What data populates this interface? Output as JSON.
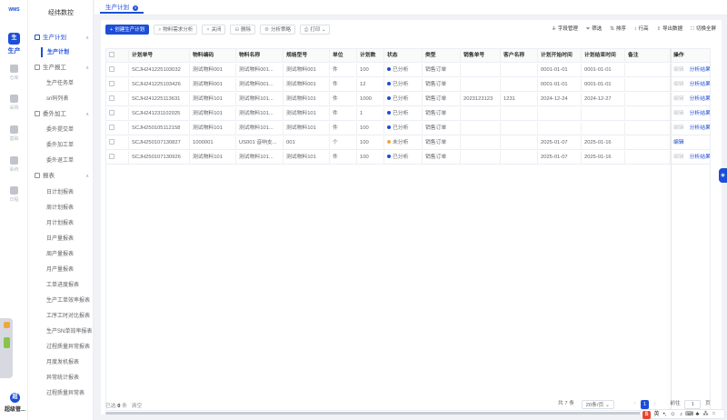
{
  "rail": {
    "logo": "WMS",
    "items": [
      {
        "label": "生产",
        "active": true
      },
      {
        "label": "仓库"
      },
      {
        "label": "采购"
      },
      {
        "label": "基础"
      },
      {
        "label": "系统"
      },
      {
        "label": "日程"
      }
    ],
    "user_label": "超级管..."
  },
  "sidebar": {
    "title": "经纬数控",
    "groups": [
      {
        "label": "生产计划",
        "active": true,
        "items": [
          {
            "label": "生产计划",
            "active": true
          }
        ]
      },
      {
        "label": "生产报工",
        "items": [
          {
            "label": "生产任务单"
          },
          {
            "label": "sn码列表"
          }
        ]
      },
      {
        "label": "委外加工",
        "items": [
          {
            "label": "委外提交单"
          },
          {
            "label": "委外加工单"
          },
          {
            "label": "委外退工单"
          }
        ]
      },
      {
        "label": "报表",
        "items": [
          {
            "label": "日计划报表"
          },
          {
            "label": "周计划报表"
          },
          {
            "label": "月计划报表"
          },
          {
            "label": "日产量报表"
          },
          {
            "label": "周产量报表"
          },
          {
            "label": "月产量报表"
          },
          {
            "label": "工单进度报表"
          },
          {
            "label": "生产工单效率报表"
          },
          {
            "label": "工序工时对比报表"
          },
          {
            "label": "生产SN单效率报表"
          },
          {
            "label": "过程质量异常报表"
          },
          {
            "label": "月度发机报表"
          },
          {
            "label": "异常统计报表"
          },
          {
            "label": "过程质量异常表"
          }
        ]
      }
    ]
  },
  "tab": {
    "label": "生产计划"
  },
  "toolbar": {
    "create": "创建生产计划",
    "analyze": "物料需求分析",
    "close": "关闭",
    "delete": "删除",
    "strategy": "分析策略",
    "print": "打印",
    "fields": "字段管理",
    "filter": "筛选",
    "sort": "排序",
    "row_height": "行高",
    "export": "导出数据",
    "fullscreen": "切换全屏"
  },
  "table": {
    "columns": [
      "计划单号",
      "物料编码",
      "物料名称",
      "规格型号",
      "单位",
      "计划数",
      "状态",
      "类型",
      "销售单号",
      "客户名称",
      "计划开始时间",
      "计划结束时间",
      "备注",
      "操作"
    ],
    "rows": [
      {
        "plan_no": "SCJH241225103032",
        "code": "测试物料001",
        "name": "测试物料001...",
        "spec": "测试物料001",
        "unit": "件",
        "qty": "100",
        "status": "已分析",
        "status_color": "#1d4ed8",
        "type": "销售订单",
        "sales_no": "",
        "customer": "",
        "start": "0001-01-01",
        "end": "0001-01-01",
        "remark": "",
        "actions": [
          "编辑",
          "分析结果"
        ],
        "edit_disabled": true
      },
      {
        "plan_no": "SCJH241225103426",
        "code": "测试物料001",
        "name": "测试物料001...",
        "spec": "测试物料001",
        "unit": "件",
        "qty": "12",
        "status": "已分析",
        "status_color": "#1d4ed8",
        "type": "销售订单",
        "sales_no": "",
        "customer": "",
        "start": "0001-01-01",
        "end": "0001-01-01",
        "remark": "",
        "actions": [
          "编辑",
          "分析结果"
        ],
        "edit_disabled": true
      },
      {
        "plan_no": "SCJH241225113631",
        "code": "测试物料101",
        "name": "测试物料101...",
        "spec": "测试物料101",
        "unit": "件",
        "qty": "1000",
        "status": "已分析",
        "status_color": "#1d4ed8",
        "type": "销售订单",
        "sales_no": "2023123123",
        "customer": "1231",
        "start": "2024-12-24",
        "end": "2024-12-27",
        "remark": "",
        "actions": [
          "编辑",
          "分析结果"
        ],
        "edit_disabled": true
      },
      {
        "plan_no": "SCJH241231102025",
        "code": "测试物料101",
        "name": "测试物料101...",
        "spec": "测试物料101",
        "unit": "件",
        "qty": "1",
        "status": "已分析",
        "status_color": "#1d4ed8",
        "type": "销售订单",
        "sales_no": "",
        "customer": "",
        "start": "",
        "end": "",
        "remark": "",
        "actions": [
          "编辑",
          "分析结果"
        ],
        "edit_disabled": true
      },
      {
        "plan_no": "SCJH250105112158",
        "code": "测试物料101",
        "name": "测试物料101...",
        "spec": "测试物料101",
        "unit": "件",
        "qty": "100",
        "status": "已分析",
        "status_color": "#1d4ed8",
        "type": "销售订单",
        "sales_no": "",
        "customer": "",
        "start": "",
        "end": "",
        "remark": "",
        "actions": [
          "编辑",
          "分析结果"
        ],
        "edit_disabled": true
      },
      {
        "plan_no": "SCJH250107130827",
        "code": "1000001",
        "name": "US001 音响支...",
        "spec": "001",
        "unit": "个",
        "qty": "100",
        "status": "未分析",
        "status_color": "#f0a640",
        "type": "销售订单",
        "sales_no": "",
        "customer": "",
        "start": "2025-01-07",
        "end": "2025-01-16",
        "remark": "",
        "actions": [
          "编辑"
        ],
        "edit_disabled": false
      },
      {
        "plan_no": "SCJH250107130926",
        "code": "测试物料101",
        "name": "测试物料101...",
        "spec": "测试物料101",
        "unit": "件",
        "qty": "100",
        "status": "已分析",
        "status_color": "#1d4ed8",
        "type": "销售订单",
        "sales_no": "",
        "customer": "",
        "start": "2025-01-07",
        "end": "2025-01-16",
        "remark": "",
        "actions": [
          "编辑",
          "分析结果"
        ],
        "edit_disabled": true
      }
    ]
  },
  "footer": {
    "selected_prefix": "已选",
    "selected_count": "0",
    "selected_suffix": "条",
    "clear": "清空"
  },
  "pager": {
    "total": "共 7 条",
    "page_size": "20条/页",
    "prev": "‹",
    "page": "1",
    "next": "›",
    "goto_label": "前往",
    "goto_value": "1",
    "goto_unit": "页"
  },
  "ime": {
    "lang": "英"
  },
  "colors": {
    "primary": "#1d4ed8",
    "warning": "#f0a640"
  }
}
